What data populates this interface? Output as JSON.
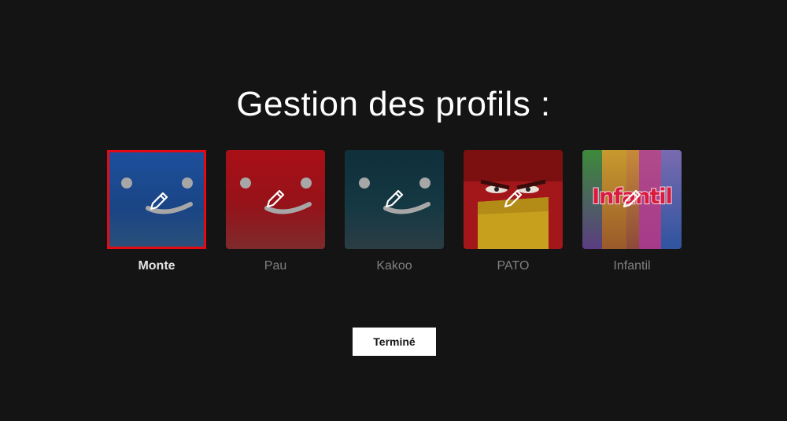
{
  "page": {
    "title": "Gestion des profils :"
  },
  "profiles": [
    {
      "name": "Monte",
      "selected": true,
      "avatar_color": "#1f4e96",
      "icon": "smiley-face-icon"
    },
    {
      "name": "Pau",
      "selected": false,
      "avatar_color": "#b0121b",
      "icon": "smiley-face-icon"
    },
    {
      "name": "Kakoo",
      "selected": false,
      "avatar_color": "#123a48",
      "icon": "smiley-face-icon"
    },
    {
      "name": "PATO",
      "selected": false,
      "avatar_color": "#b01a1a",
      "icon": "character-avatar-icon"
    },
    {
      "name": "Infantil",
      "selected": false,
      "avatar_color": "#7a4da0",
      "icon": "kids-avatar-icon",
      "logo_text": "Infantil"
    }
  ],
  "actions": {
    "done_label": "Terminé"
  },
  "colors": {
    "background": "#141414",
    "selected_border": "#e50914",
    "button_bg": "#ffffff"
  }
}
